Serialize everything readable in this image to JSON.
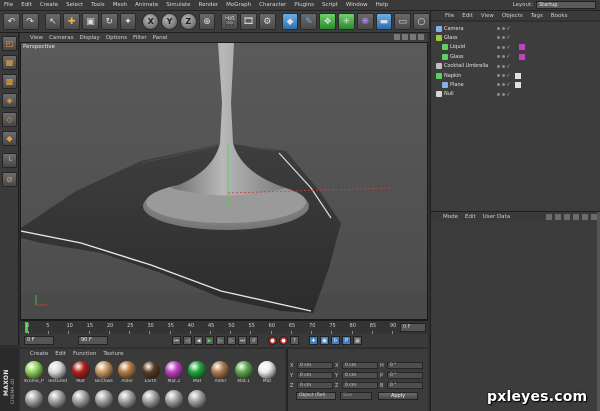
{
  "menubar": {
    "items": [
      "File",
      "Edit",
      "Create",
      "Select",
      "Tools",
      "Mesh",
      "Animate",
      "Simulate",
      "Render",
      "MoGraph",
      "Character",
      "Plugins",
      "Script",
      "Window",
      "Help"
    ],
    "layout_label": "Layout:",
    "layout_value": "Startup"
  },
  "toolbar": {
    "axis_x": "X",
    "axis_y": "Y",
    "axis_z": "Z"
  },
  "viewport": {
    "menu": [
      "View",
      "Cameras",
      "Display",
      "Options",
      "Filter",
      "Panel"
    ],
    "label": "Perspective"
  },
  "timeline": {
    "ticks": [
      "0",
      "5",
      "10",
      "15",
      "20",
      "25",
      "30",
      "35",
      "40",
      "45",
      "50",
      "55",
      "60",
      "65",
      "70",
      "75",
      "80",
      "85",
      "90"
    ],
    "current_frame": "0 F"
  },
  "transport": {
    "start": "0 F",
    "end": "90 F"
  },
  "materials": {
    "menu": [
      "Create",
      "Edit",
      "Function",
      "Texture"
    ],
    "items": [
      {
        "name": "Krome_P",
        "color": "#8fd45a"
      },
      {
        "name": "Textured",
        "color": "#d8d8d8"
      },
      {
        "name": "Mat",
        "color": "#b0201c"
      },
      {
        "name": "Birchwe",
        "color": "#c89860"
      },
      {
        "name": "Alder",
        "color": "#b57a45"
      },
      {
        "name": "Earth",
        "color": "#5a3a22"
      },
      {
        "name": "Mat.2",
        "color": "#c040c0"
      },
      {
        "name": "Mat",
        "color": "#1fa63c"
      },
      {
        "name": "Alder",
        "color": "#ad7a50"
      },
      {
        "name": "Mat.1",
        "color": "#5fa64a"
      },
      {
        "name": "Mat",
        "color": "#ececec"
      }
    ]
  },
  "coords": {
    "rows": [
      {
        "a": "X",
        "v1": "0 cm",
        "b": "X",
        "v2": "0 cm",
        "c": "H",
        "v3": "0 °"
      },
      {
        "a": "Y",
        "v1": "0 cm",
        "b": "Y",
        "v2": "0 cm",
        "c": "P",
        "v3": "0 °"
      },
      {
        "a": "Z",
        "v1": "0 cm",
        "b": "Z",
        "v2": "0 cm",
        "c": "B",
        "v3": "0 °"
      }
    ],
    "mode": "Object (Rel)",
    "size_mode": "Size",
    "apply": "Apply"
  },
  "object_manager": {
    "menu": [
      "File",
      "Edit",
      "View",
      "Objects",
      "Tags",
      "Books"
    ],
    "objects": [
      {
        "name": "Camera",
        "icon_color": "#7fb2e6",
        "indent": 0
      },
      {
        "name": "Glass",
        "icon_color": "#9acd32",
        "indent": 0
      },
      {
        "name": "Liquid",
        "icon_color": "#5fd05f",
        "indent": 1
      },
      {
        "name": "Glass",
        "icon_color": "#5fd05f",
        "indent": 1
      },
      {
        "name": "Cocktail Umbrella",
        "icon_color": "#c0c0c0",
        "indent": 0
      },
      {
        "name": "Napkin",
        "icon_color": "#5fd05f",
        "indent": 0
      },
      {
        "name": "Plane",
        "icon_color": "#8ab0e0",
        "indent": 1
      },
      {
        "name": "Null",
        "icon_color": "#d8d8d8",
        "indent": 0
      }
    ]
  },
  "attribute_manager": {
    "menu": [
      "Mode",
      "Edit",
      "User Data"
    ]
  },
  "brand": {
    "name": "MAXON",
    "sub": "CINEMA 4D"
  },
  "watermark": "pxleyes.com"
}
